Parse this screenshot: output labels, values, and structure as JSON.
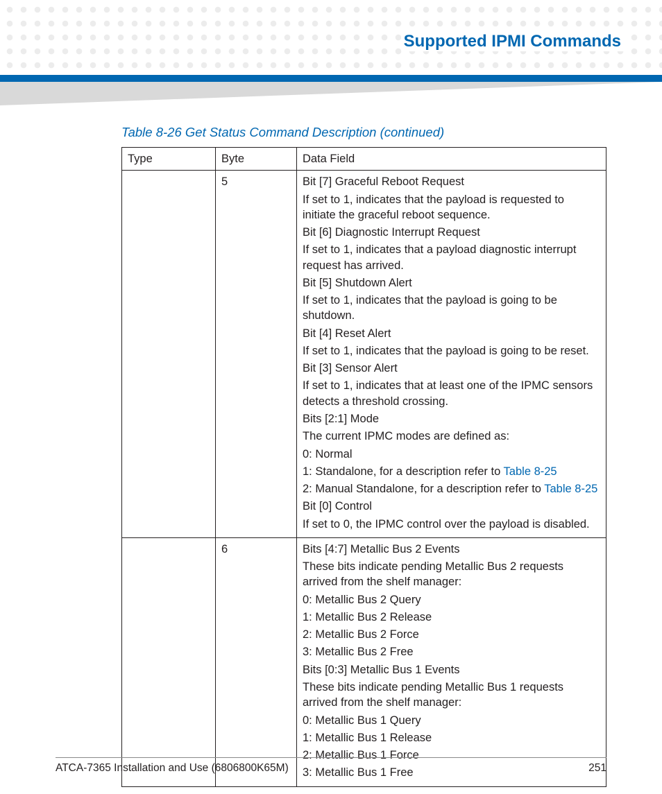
{
  "header": {
    "title": "Supported IPMI Commands"
  },
  "caption": "Table 8-26 Get Status Command Description (continued)",
  "table": {
    "headers": {
      "type": "Type",
      "byte": "Byte",
      "data_field": "Data Field"
    },
    "rows": [
      {
        "type": "",
        "byte": "5",
        "lines": [
          {
            "text": "Bit [7] Graceful Reboot Request"
          },
          {
            "text": "If set to 1, indicates that the payload is requested to initiate the graceful reboot sequence."
          },
          {
            "text": "Bit [6] Diagnostic Interrupt Request"
          },
          {
            "text": "If set to 1, indicates that a payload diagnostic interrupt request has arrived."
          },
          {
            "text": "Bit [5] Shutdown Alert"
          },
          {
            "text": "If set to 1, indicates that the payload is going to be shutdown."
          },
          {
            "text": "Bit [4] Reset Alert"
          },
          {
            "text": "If set to 1, indicates that the payload is going to be reset."
          },
          {
            "text": "Bit [3] Sensor Alert"
          },
          {
            "text": "If set to 1, indicates that at least one of the IPMC sensors detects a threshold crossing."
          },
          {
            "text": "Bits [2:1] Mode"
          },
          {
            "text": "The current IPMC modes are defined as:"
          },
          {
            "text": "0: Normal"
          },
          {
            "prefix": "1: Standalone, for a description refer to ",
            "link": "Table 8-25"
          },
          {
            "prefix": "2: Manual Standalone, for a description refer to ",
            "link": "Table 8-25"
          },
          {
            "text": "Bit [0] Control"
          },
          {
            "text": "If set to 0, the IPMC control over the payload is disabled."
          }
        ]
      },
      {
        "type": "",
        "byte": "6",
        "lines": [
          {
            "text": "Bits [4:7] Metallic Bus 2 Events"
          },
          {
            "text": "These bits indicate pending Metallic Bus 2 requests arrived from the shelf manager:"
          },
          {
            "text": "0: Metallic Bus 2 Query"
          },
          {
            "text": "1: Metallic Bus 2 Release"
          },
          {
            "text": "2: Metallic Bus 2 Force"
          },
          {
            "text": "3: Metallic Bus 2 Free"
          },
          {
            "text": "Bits [0:3] Metallic Bus 1 Events"
          },
          {
            "text": "These bits indicate pending Metallic Bus 1 requests arrived from the shelf manager:"
          },
          {
            "text": "0: Metallic Bus 1 Query"
          },
          {
            "text": "1: Metallic Bus 1 Release"
          },
          {
            "text": "2: Metallic Bus 1 Force"
          },
          {
            "text": "3: Metallic Bus 1 Free"
          }
        ]
      }
    ]
  },
  "footer": {
    "left": "ATCA-7365 Installation and Use (6806800K65M)",
    "right": "251"
  }
}
